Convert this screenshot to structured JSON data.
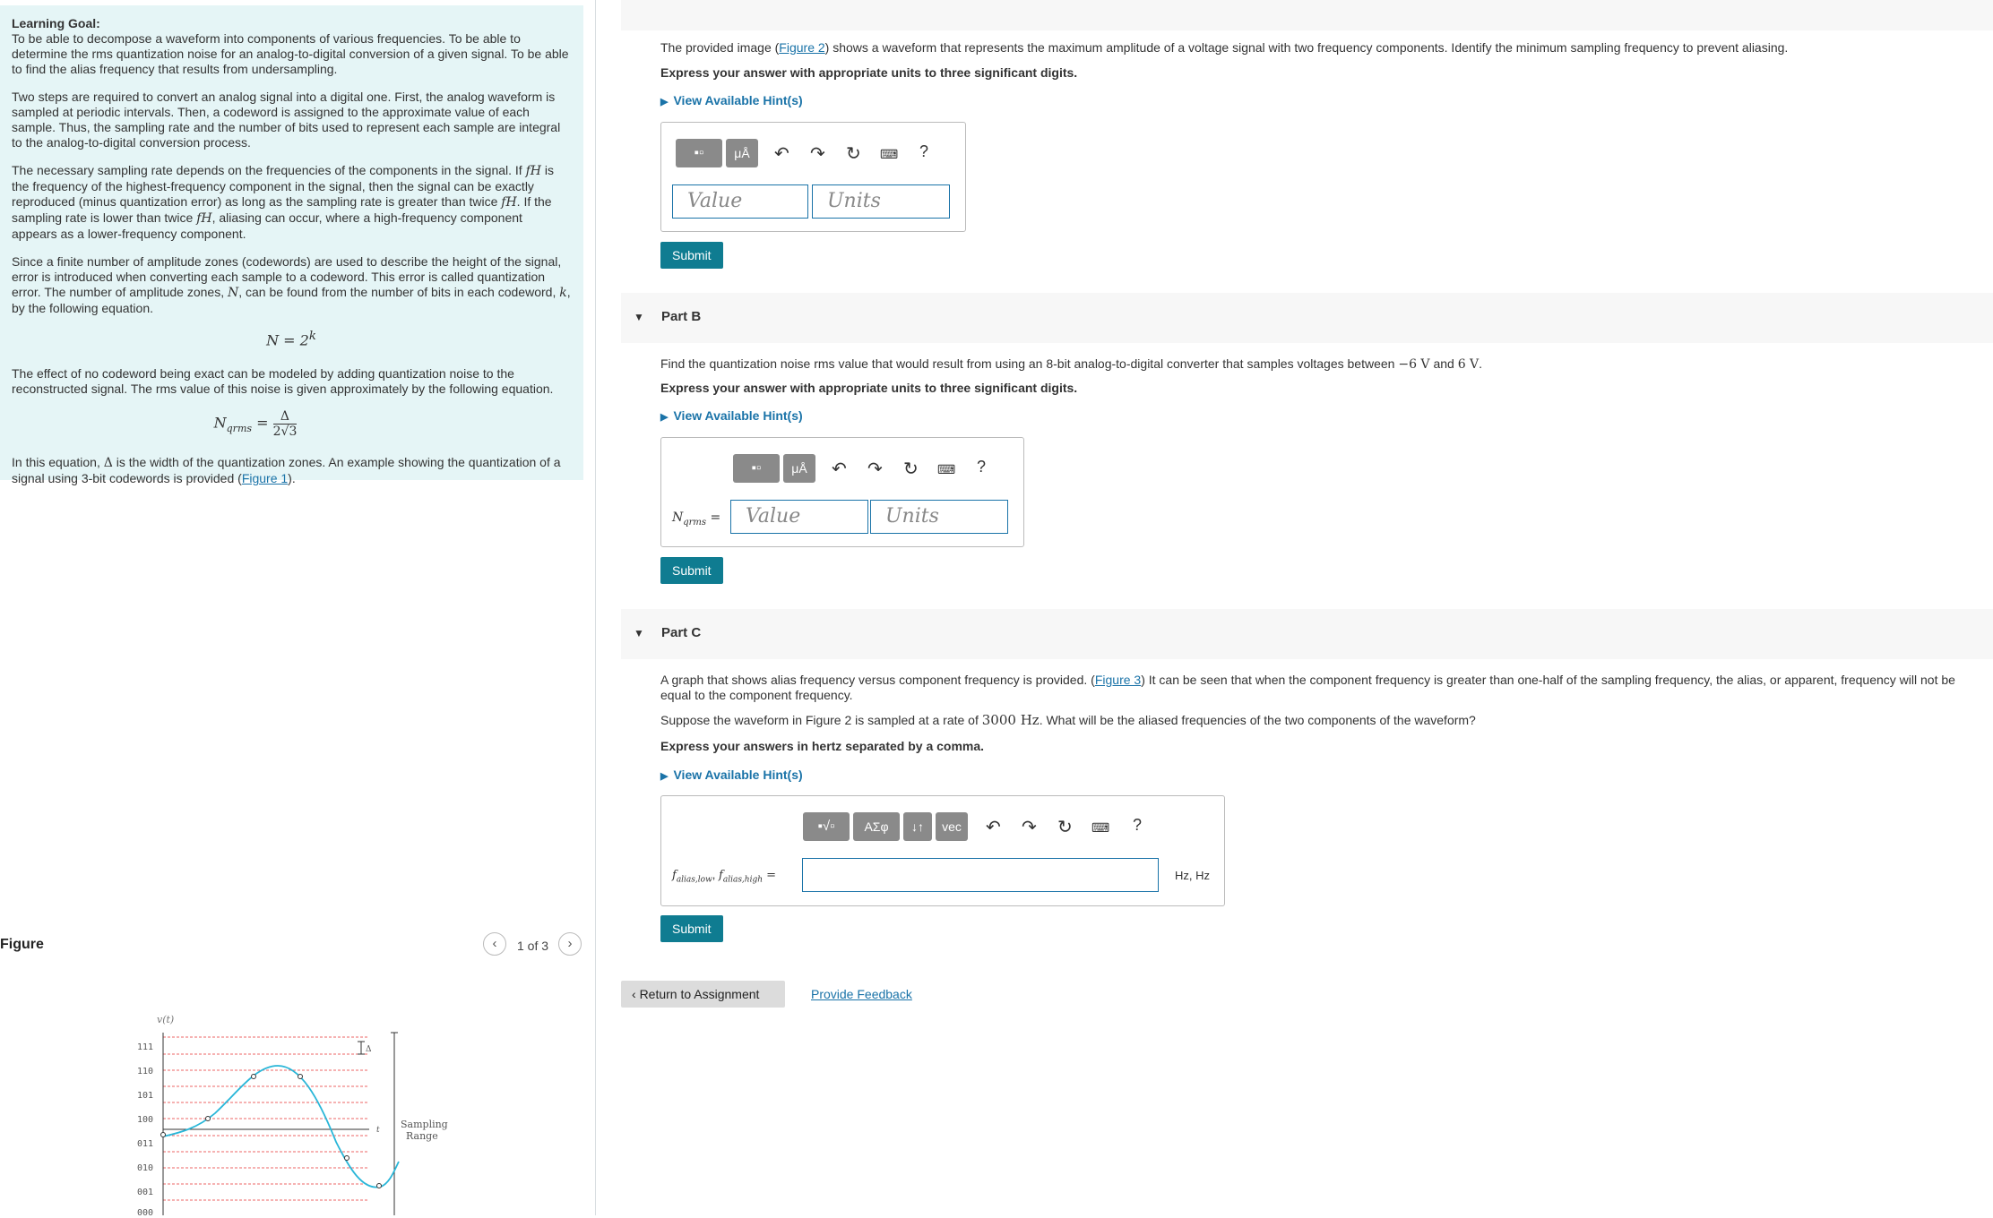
{
  "goal": {
    "title": "Learning Goal:",
    "intro": "To be able to decompose a waveform into components of various frequencies. To be able to determine the rms quantization noise for an analog-to-digital conversion of a given signal. To be able to find the alias frequency that results from undersampling.",
    "p2": "Two steps are required to convert an analog signal into a digital one. First, the analog waveform is sampled at periodic intervals. Then, a codeword is assigned to the approximate value of each sample. Thus, the sampling rate and the number of bits used to represent each sample are integral to the analog-to-digital conversion process.",
    "p3a": "The necessary sampling rate depends on the frequencies of the components in the signal. If",
    "p3b": "is the frequency of the highest-frequency component in the signal, then the signal can be exactly reproduced (minus quantization error) as long as the sampling rate is greater than twice",
    "p3c": ". If the sampling rate is lower than twice",
    "p3d": ", aliasing can occur, where a high-frequency component appears as a lower-frequency component.",
    "fh": "fH",
    "p4a": "Since a finite number of amplitude zones (codewords) are used to describe the height of the signal, error is introduced when converting each sample to a codeword. This error is called quantization error. The number of amplitude zones,",
    "p4b": ", can be found from the number of bits in each codeword,",
    "p4c": ", by the following equation.",
    "N": "N",
    "k": "k",
    "eq1_lhs": "N = 2",
    "eq1_exp": "k",
    "p5": "The effect of no codeword being exact can be modeled by adding quantization noise to the reconstructed signal. The rms value of this noise is given approximately by the following equation.",
    "eq2_lhs": "N",
    "eq2_sub": "qrms",
    "eq2_eq": " = ",
    "eq2_num": "Δ",
    "eq2_den": "2√3",
    "p6a": "In this equation,",
    "delta": "Δ",
    "p6b": "is the width of the quantization zones. An example showing the quantization of a signal using 3-bit codewords is provided (",
    "fig1_link": "Figure 1",
    "p6c": ")."
  },
  "figure": {
    "title": "Figure",
    "counter": "1 of 3",
    "prev": "‹",
    "next": "›",
    "ylabel": "v(t)",
    "codes": [
      "111",
      "110",
      "101",
      "100",
      "011",
      "010",
      "001",
      "000"
    ],
    "delta_label": "Δ",
    "t_label": "t",
    "sampling_label_1": "Sampling",
    "sampling_label_2": "Range"
  },
  "partA": {
    "text_a": "The provided image (",
    "link": "Figure 2",
    "text_b": ") shows a waveform that represents the maximum amplitude of a voltage signal with two frequency components. Identify the minimum sampling frequency to prevent aliasing.",
    "instruction": "Express your answer with appropriate units to three significant digits.",
    "hints": "View Available Hint(s)",
    "value_placeholder": "Value",
    "units_placeholder": "Units",
    "submit": "Submit"
  },
  "partB": {
    "title": "Part B",
    "text_a": "Find the quantization noise rms value that would result from using an 8-bit analog-to-digital converter that samples voltages between",
    "v1": "−6 V",
    "and": "and",
    "v2": "6 V",
    "period": ".",
    "instruction": "Express your answer with appropriate units to three significant digits.",
    "hints": "View Available Hint(s)",
    "label_N": "N",
    "label_sub": "qrms",
    "label_eq": " =",
    "value_placeholder": "Value",
    "units_placeholder": "Units",
    "submit": "Submit"
  },
  "partC": {
    "title": "Part C",
    "text_a": "A graph that shows alias frequency versus component frequency is provided. (",
    "link": "Figure 3",
    "text_b": ") It can be seen that when the component frequency is greater than one-half of the sampling frequency, the alias, or apparent, frequency will not be equal to the component frequency.",
    "text2_a": "Suppose the waveform in Figure 2 is sampled at a rate of",
    "rate": "3000 Hz",
    "text2_b": ". What will be the aliased frequencies of the two components of the waveform?",
    "instruction": "Express your answers in hertz separated by a comma.",
    "hints": "View Available Hint(s)",
    "label_f1": "f",
    "label_f1_sub": "alias,low",
    "label_sep": ", ",
    "label_f2": "f",
    "label_f2_sub": "alias,high",
    "label_eq": " =",
    "units": "Hz, Hz",
    "tb_greek": "ΑΣφ",
    "tb_arrows": "↓↑",
    "tb_vec": "vec",
    "submit": "Submit"
  },
  "toolbar": {
    "mu": "μÅ",
    "help": "?"
  },
  "footer": {
    "return": "Return to Assignment",
    "feedback": "Provide Feedback"
  }
}
